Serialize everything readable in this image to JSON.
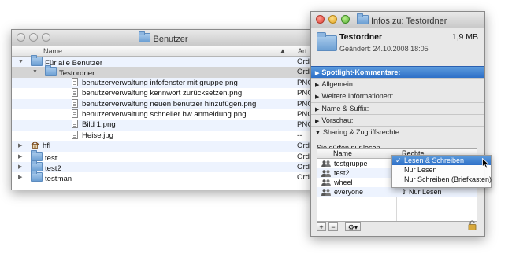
{
  "finder": {
    "title": "Benutzer",
    "columns": {
      "name": "Name",
      "kind": "Art"
    },
    "rows": [
      {
        "name": "Für alle Benutzer",
        "kind": "Ordn",
        "type": "folder",
        "indent": 0,
        "expanded": true
      },
      {
        "name": "Testordner",
        "kind": "Ordn",
        "type": "folder",
        "indent": 1,
        "expanded": true
      },
      {
        "name": "benutzerverwaltung infofenster mit gruppe.png",
        "kind": "PNG-",
        "type": "doc",
        "indent": 2
      },
      {
        "name": "benutzerverwaltung kennwort zurücksetzen.png",
        "kind": "PNG-",
        "type": "doc",
        "indent": 2
      },
      {
        "name": "benutzerverwaltung neuen benutzer hinzufügen.png",
        "kind": "PNG-",
        "type": "doc",
        "indent": 2
      },
      {
        "name": "benutzerverwaltung schneller bw anmeldung.png",
        "kind": "PNG-",
        "type": "doc",
        "indent": 2
      },
      {
        "name": "Bild 1.png",
        "kind": "PNG-",
        "type": "doc",
        "indent": 2
      },
      {
        "name": "Heise.jpg",
        "kind": "--",
        "type": "doc",
        "indent": 2
      },
      {
        "name": "hfl",
        "kind": "Ordn",
        "type": "home",
        "indent": 0,
        "expanded": false
      },
      {
        "name": "test",
        "kind": "Ordn",
        "type": "folder",
        "indent": 0,
        "expanded": false
      },
      {
        "name": "test2",
        "kind": "Ordn",
        "type": "folder",
        "indent": 0,
        "expanded": false
      },
      {
        "name": "testman",
        "kind": "Ordn",
        "type": "folder",
        "indent": 0,
        "expanded": false
      }
    ]
  },
  "info": {
    "title": "Infos zu: Testordner",
    "name": "Testordner",
    "size": "1,9 MB",
    "modified": "Geändert: 24.10.2008 18:05",
    "sections": [
      "Spotlight-Kommentare:",
      "Allgemein:",
      "Weitere Informationen:",
      "Name & Suffix:",
      "Vorschau:",
      "Sharing & Zugriffsrechte:"
    ],
    "permissions_note": "Sie dürfen nur lesen",
    "table_headers": {
      "name": "Name",
      "rights": "Rechte"
    },
    "users": [
      {
        "name": "testgruppe",
        "rights": ""
      },
      {
        "name": "test2",
        "rights": ""
      },
      {
        "name": "wheel",
        "rights": ""
      },
      {
        "name": "everyone",
        "rights": "Nur Lesen"
      }
    ],
    "add_label": "+",
    "remove_label": "−",
    "action_label": "⚙▾"
  },
  "menu": {
    "items": [
      {
        "label": "Lesen & Schreiben",
        "checked": true
      },
      {
        "label": "Nur Lesen",
        "checked": false
      },
      {
        "label": "Nur Schreiben (Briefkasten)",
        "checked": false
      }
    ],
    "check_glyph": "✓"
  },
  "colors": {
    "selection": "#2d6fc7",
    "alt_row": "#edf3fe",
    "folder": "#6c9fd3"
  }
}
